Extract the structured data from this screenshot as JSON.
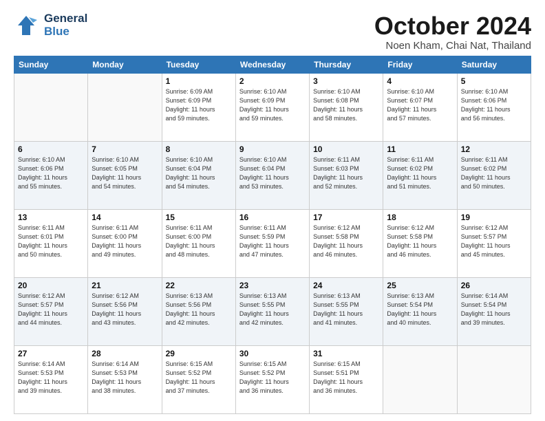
{
  "header": {
    "logo_line1": "General",
    "logo_line2": "Blue",
    "month": "October 2024",
    "location": "Noen Kham, Chai Nat, Thailand"
  },
  "days_of_week": [
    "Sunday",
    "Monday",
    "Tuesday",
    "Wednesday",
    "Thursday",
    "Friday",
    "Saturday"
  ],
  "weeks": [
    [
      {
        "day": "",
        "info": ""
      },
      {
        "day": "",
        "info": ""
      },
      {
        "day": "1",
        "info": "Sunrise: 6:09 AM\nSunset: 6:09 PM\nDaylight: 11 hours\nand 59 minutes."
      },
      {
        "day": "2",
        "info": "Sunrise: 6:10 AM\nSunset: 6:09 PM\nDaylight: 11 hours\nand 59 minutes."
      },
      {
        "day": "3",
        "info": "Sunrise: 6:10 AM\nSunset: 6:08 PM\nDaylight: 11 hours\nand 58 minutes."
      },
      {
        "day": "4",
        "info": "Sunrise: 6:10 AM\nSunset: 6:07 PM\nDaylight: 11 hours\nand 57 minutes."
      },
      {
        "day": "5",
        "info": "Sunrise: 6:10 AM\nSunset: 6:06 PM\nDaylight: 11 hours\nand 56 minutes."
      }
    ],
    [
      {
        "day": "6",
        "info": "Sunrise: 6:10 AM\nSunset: 6:06 PM\nDaylight: 11 hours\nand 55 minutes."
      },
      {
        "day": "7",
        "info": "Sunrise: 6:10 AM\nSunset: 6:05 PM\nDaylight: 11 hours\nand 54 minutes."
      },
      {
        "day": "8",
        "info": "Sunrise: 6:10 AM\nSunset: 6:04 PM\nDaylight: 11 hours\nand 54 minutes."
      },
      {
        "day": "9",
        "info": "Sunrise: 6:10 AM\nSunset: 6:04 PM\nDaylight: 11 hours\nand 53 minutes."
      },
      {
        "day": "10",
        "info": "Sunrise: 6:11 AM\nSunset: 6:03 PM\nDaylight: 11 hours\nand 52 minutes."
      },
      {
        "day": "11",
        "info": "Sunrise: 6:11 AM\nSunset: 6:02 PM\nDaylight: 11 hours\nand 51 minutes."
      },
      {
        "day": "12",
        "info": "Sunrise: 6:11 AM\nSunset: 6:02 PM\nDaylight: 11 hours\nand 50 minutes."
      }
    ],
    [
      {
        "day": "13",
        "info": "Sunrise: 6:11 AM\nSunset: 6:01 PM\nDaylight: 11 hours\nand 50 minutes."
      },
      {
        "day": "14",
        "info": "Sunrise: 6:11 AM\nSunset: 6:00 PM\nDaylight: 11 hours\nand 49 minutes."
      },
      {
        "day": "15",
        "info": "Sunrise: 6:11 AM\nSunset: 6:00 PM\nDaylight: 11 hours\nand 48 minutes."
      },
      {
        "day": "16",
        "info": "Sunrise: 6:11 AM\nSunset: 5:59 PM\nDaylight: 11 hours\nand 47 minutes."
      },
      {
        "day": "17",
        "info": "Sunrise: 6:12 AM\nSunset: 5:58 PM\nDaylight: 11 hours\nand 46 minutes."
      },
      {
        "day": "18",
        "info": "Sunrise: 6:12 AM\nSunset: 5:58 PM\nDaylight: 11 hours\nand 46 minutes."
      },
      {
        "day": "19",
        "info": "Sunrise: 6:12 AM\nSunset: 5:57 PM\nDaylight: 11 hours\nand 45 minutes."
      }
    ],
    [
      {
        "day": "20",
        "info": "Sunrise: 6:12 AM\nSunset: 5:57 PM\nDaylight: 11 hours\nand 44 minutes."
      },
      {
        "day": "21",
        "info": "Sunrise: 6:12 AM\nSunset: 5:56 PM\nDaylight: 11 hours\nand 43 minutes."
      },
      {
        "day": "22",
        "info": "Sunrise: 6:13 AM\nSunset: 5:56 PM\nDaylight: 11 hours\nand 42 minutes."
      },
      {
        "day": "23",
        "info": "Sunrise: 6:13 AM\nSunset: 5:55 PM\nDaylight: 11 hours\nand 42 minutes."
      },
      {
        "day": "24",
        "info": "Sunrise: 6:13 AM\nSunset: 5:55 PM\nDaylight: 11 hours\nand 41 minutes."
      },
      {
        "day": "25",
        "info": "Sunrise: 6:13 AM\nSunset: 5:54 PM\nDaylight: 11 hours\nand 40 minutes."
      },
      {
        "day": "26",
        "info": "Sunrise: 6:14 AM\nSunset: 5:54 PM\nDaylight: 11 hours\nand 39 minutes."
      }
    ],
    [
      {
        "day": "27",
        "info": "Sunrise: 6:14 AM\nSunset: 5:53 PM\nDaylight: 11 hours\nand 39 minutes."
      },
      {
        "day": "28",
        "info": "Sunrise: 6:14 AM\nSunset: 5:53 PM\nDaylight: 11 hours\nand 38 minutes."
      },
      {
        "day": "29",
        "info": "Sunrise: 6:15 AM\nSunset: 5:52 PM\nDaylight: 11 hours\nand 37 minutes."
      },
      {
        "day": "30",
        "info": "Sunrise: 6:15 AM\nSunset: 5:52 PM\nDaylight: 11 hours\nand 36 minutes."
      },
      {
        "day": "31",
        "info": "Sunrise: 6:15 AM\nSunset: 5:51 PM\nDaylight: 11 hours\nand 36 minutes."
      },
      {
        "day": "",
        "info": ""
      },
      {
        "day": "",
        "info": ""
      }
    ]
  ]
}
